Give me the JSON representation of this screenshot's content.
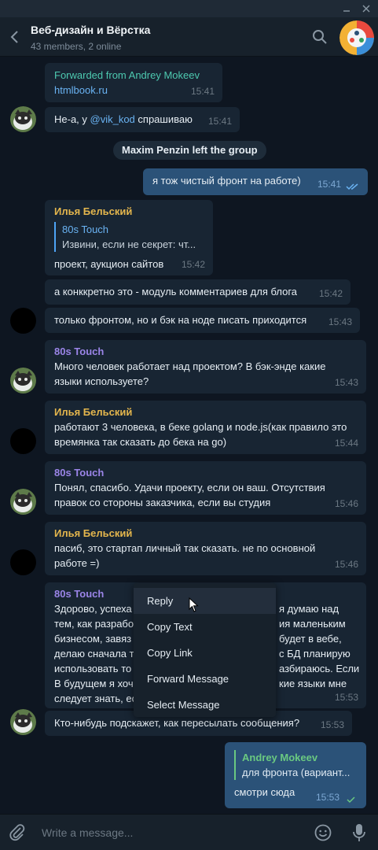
{
  "window": {
    "minimize_icon": "minimize-icon",
    "close_icon": "close-icon"
  },
  "header": {
    "title": "Веб-дизайн и Вёрстка",
    "subtitle": "43 members, 2 online"
  },
  "service_message": "Maxim Penzin left the group",
  "messages": [
    {
      "id": "m1",
      "forwarded_from": "Forwarded from Andrey Mokeev",
      "text": "htmlbook.ru",
      "time": "15:41"
    },
    {
      "id": "m2",
      "text_before": "Не-а, у ",
      "mention": "@vik_kod",
      "text_after": "  спрашиваю",
      "time": "15:41"
    },
    {
      "id": "m3",
      "text": "я тож чистый фронт на работе)",
      "time": "15:41",
      "read": true
    },
    {
      "id": "m4",
      "author": "Илья Бельский",
      "reply_name": "80s Touch",
      "reply_text": "Извини, если не секрет: чт...",
      "text": "проект, аукцион сайтов",
      "time": "15:42"
    },
    {
      "id": "m5",
      "text": "а конккретно это - модуль комментариев для блога",
      "time": "15:42"
    },
    {
      "id": "m6",
      "text": "только фронтом, но и бэк на ноде писать приходится",
      "time": "15:43"
    },
    {
      "id": "m7",
      "author": "80s Touch",
      "line1": "Много человек работает над проектом? В бэк-энде какие",
      "line2": "языки используете?",
      "time": "15:43"
    },
    {
      "id": "m8",
      "author": "Илья Бельский",
      "line1": "работают 3 человека, в беке golang и node.js(как правило это",
      "line2": "времянка так сказать до бека на go)",
      "time": "15:44"
    },
    {
      "id": "m9",
      "author": "80s Touch",
      "line1": "Понял, спасибо. Удачи проекту, если он ваш. Отсутствия",
      "line2": "правок со стороны заказчика, если вы студия",
      "time": "15:46"
    },
    {
      "id": "m10",
      "author": "Илья Бельский",
      "line1": "пасиб, это стартап личный так сказать. не по основной",
      "line2": "работе =)",
      "time": "15:46"
    },
    {
      "id": "m11",
      "author": "80s Touch",
      "left_lines": [
        "Здорово, успеха",
        "тем, как разрабо",
        "бизнесом, завяз",
        "делаю сначала т",
        "использовать то",
        "В будущем я хоч",
        "следует знать, ес"
      ],
      "right_lines": [
        "я думаю над",
        "ия маленьким",
        "будет в вебе,",
        "с БД планирую",
        "азбираюсь. Если",
        "кие языки мне",
        ""
      ],
      "time": "15:53"
    },
    {
      "id": "m12",
      "text": "Кто-нибудь подскажет, как пересылать сообщения?",
      "time": "15:53"
    },
    {
      "id": "m13",
      "reply_name": "Andrey Mokeev",
      "reply_text": "для фронта (вариант...",
      "text": "смотри сюда",
      "time": "15:53",
      "read": true
    }
  ],
  "context_menu": {
    "items": [
      "Reply",
      "Copy Text",
      "Copy Link",
      "Forward Message",
      "Select Message"
    ],
    "hovered": "Reply"
  },
  "composer": {
    "placeholder": "Write a message..."
  },
  "colors": {
    "background": "#0e1621",
    "bubble_in": "#182533",
    "bubble_out": "#2b5278",
    "accent_link": "#6ab3f3",
    "name_yellow": "#e4b64d",
    "name_purple": "#9b85e8",
    "forward_teal": "#4dc9b0"
  }
}
